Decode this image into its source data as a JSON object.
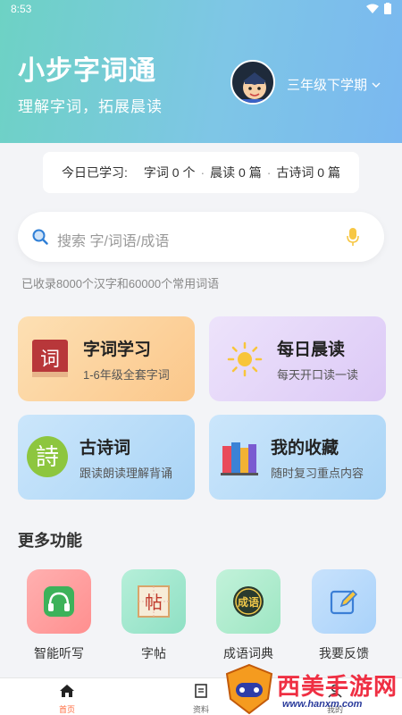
{
  "status_bar": {
    "time": "8:53"
  },
  "header": {
    "title": "小步字词通",
    "subtitle": "理解字词，拓展晨读",
    "grade": "三年级下学期"
  },
  "today": {
    "label": "今日已学习:",
    "items": [
      "字词 0 个",
      "晨读 0 篇",
      "古诗词 0 篇"
    ]
  },
  "search": {
    "placeholder": "搜索 字/词语/成语",
    "count_text": "已收录8000个汉字和60000个常用词语"
  },
  "cards": [
    {
      "title": "字词学习",
      "desc": "1-6年级全套字词",
      "icon_text": "词"
    },
    {
      "title": "每日晨读",
      "desc": "每天开口读一读",
      "icon": "sun-icon"
    },
    {
      "title": "古诗词",
      "desc": "跟读朗读理解背诵",
      "icon_text": "詩"
    },
    {
      "title": "我的收藏",
      "desc": "随时复习重点内容",
      "icon": "books-icon"
    }
  ],
  "more": {
    "title": "更多功能",
    "items": [
      {
        "label": "智能听写",
        "icon": "headphones-icon",
        "color": "#ff8f8f"
      },
      {
        "label": "字帖",
        "icon": "copybook-icon",
        "color": "#8fe0c4",
        "icon_text": "帖"
      },
      {
        "label": "成语词典",
        "icon": "idiom-icon",
        "color": "#9ee6c3",
        "icon_text": "成语"
      },
      {
        "label": "我要反馈",
        "icon": "feedback-icon",
        "color": "#a9d2fa"
      }
    ]
  },
  "tabs": [
    {
      "label": "首页",
      "active": true
    },
    {
      "label": "资料",
      "active": false
    },
    {
      "label": "我的",
      "active": false
    }
  ],
  "watermark": {
    "text": "西美手游网",
    "url": "www.hanxm.com"
  },
  "colors": {
    "accent": "#ff6a3d",
    "header_start": "#6dd2c4",
    "header_end": "#7ab8f0"
  }
}
